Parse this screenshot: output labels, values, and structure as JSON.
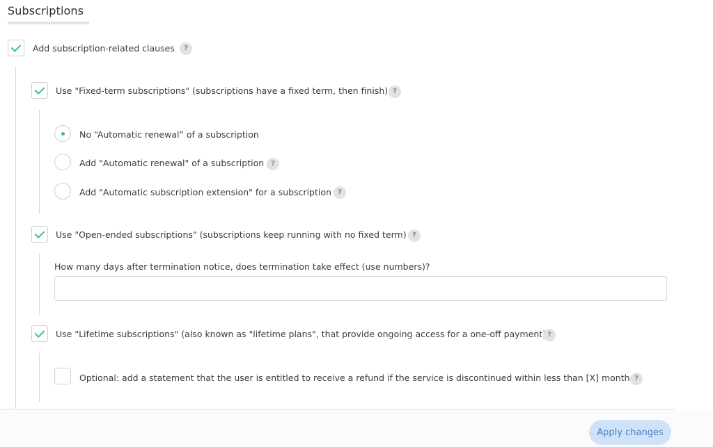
{
  "section": {
    "title": "Subscriptions"
  },
  "main_option": {
    "label": "Add subscription-related clauses",
    "checked": true,
    "help": "?"
  },
  "fixed_term": {
    "label": "Use \"Fixed-term subscriptions\" (subscriptions have a fixed term, then finish)",
    "checked": true,
    "help": "?",
    "radios": [
      {
        "label": "No “Automatic renewal” of a subscription",
        "selected": true
      },
      {
        "label": "Add \"Automatic renewal\" of a subscription",
        "selected": false,
        "help": "?"
      },
      {
        "label": "Add \"Automatic subscription extension\" for a subscription",
        "selected": false,
        "help": "?"
      }
    ]
  },
  "open_ended": {
    "label": "Use \"Open-ended subscriptions\" (subscriptions keep running with no fixed term)",
    "checked": true,
    "help": "?",
    "question": "How many days after termination notice, does termination take effect (use numbers)?",
    "value": ""
  },
  "lifetime": {
    "label": "Use \"Lifetime subscriptions\" (also known as \"lifetime plans\", that provide ongoing access for a one-off payment)",
    "checked": true,
    "help": "?",
    "optional": {
      "label": "Optional: add a statement that the user is entitled to receive a refund if the service is discontinued within less than [X] months.",
      "checked": false,
      "help": "?"
    }
  },
  "footer": {
    "apply_label": "Apply changes"
  },
  "colors": {
    "accent": "#3bbf8b",
    "button_bg": "#cfe2f8",
    "button_text": "#4a7fc0"
  },
  "icons": {
    "check": "checkmark-icon",
    "help": "help-icon",
    "radio_dot": "radio-dot-icon"
  }
}
